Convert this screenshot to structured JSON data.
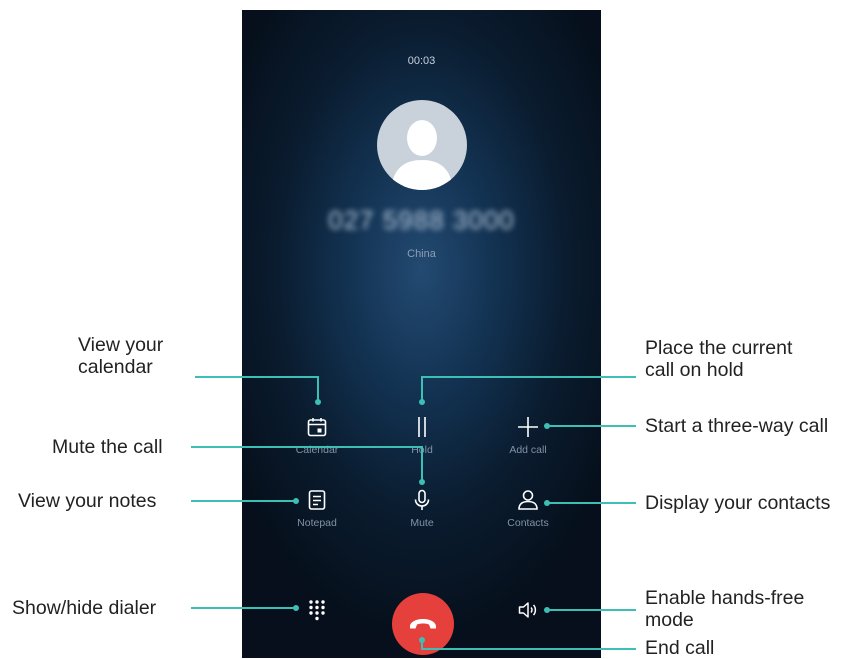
{
  "call": {
    "timer": "00:03",
    "number": "027 5988 3000",
    "region": "China"
  },
  "buttons": {
    "calendar": "Calendar",
    "hold": "Hold",
    "add_call": "Add call",
    "notepad": "Notepad",
    "mute": "Mute",
    "contacts": "Contacts"
  },
  "callouts": {
    "calendar": [
      "View your",
      "calendar"
    ],
    "hold": [
      "Place the current",
      "call on hold"
    ],
    "add_call": "Start a three-way call",
    "mute": "Mute the call",
    "notes": "View your notes",
    "contacts": "Display your contacts",
    "dialer": "Show/hide dialer",
    "speaker": [
      "Enable hands-free",
      "mode"
    ],
    "end_call": "End call"
  },
  "colors": {
    "end_call": "#e5403c",
    "callout_line": "#3dbfb3",
    "icon": "#ffffff",
    "label": "#8192a6"
  },
  "icons": {
    "calendar": "calendar-icon",
    "hold": "pause-icon",
    "add_call": "plus-icon",
    "notepad": "notepad-icon",
    "mute": "microphone-icon",
    "contacts": "person-icon",
    "dialer": "dialpad-icon",
    "speaker": "speaker-icon",
    "end_call": "hangup-icon"
  }
}
